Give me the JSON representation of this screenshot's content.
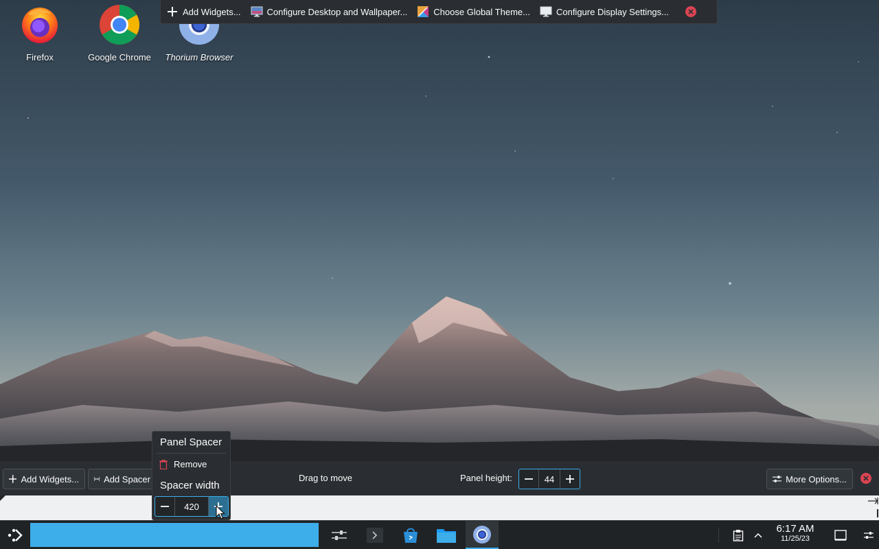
{
  "desktop": {
    "icons": [
      {
        "label": "Firefox",
        "icon": "firefox-icon"
      },
      {
        "label": "Google Chrome",
        "icon": "chrome-icon"
      },
      {
        "label": "Thorium Browser",
        "icon": "thorium-icon"
      }
    ]
  },
  "top_toolbar": {
    "add_widgets": "Add Widgets...",
    "configure_desktop": "Configure Desktop and Wallpaper...",
    "choose_theme": "Choose Global Theme...",
    "configure_display": "Configure Display Settings..."
  },
  "panel_edit": {
    "add_widgets": "Add Widgets...",
    "add_spacer": "Add Spacer",
    "drag_to_move": "Drag to move",
    "panel_height_label": "Panel height:",
    "panel_height_value": "44",
    "more_options": "More Options..."
  },
  "spacer_popup": {
    "title": "Panel Spacer",
    "remove": "Remove",
    "width_label": "Spacer width",
    "width_value": "420"
  },
  "taskbar": {
    "time": "6:17 AM",
    "date": "11/25/23",
    "spacer_width_fraction": 0.328
  },
  "colors": {
    "accent": "#3daee9",
    "close_red": "#da4453",
    "panel_bg": "#2a2e32"
  }
}
